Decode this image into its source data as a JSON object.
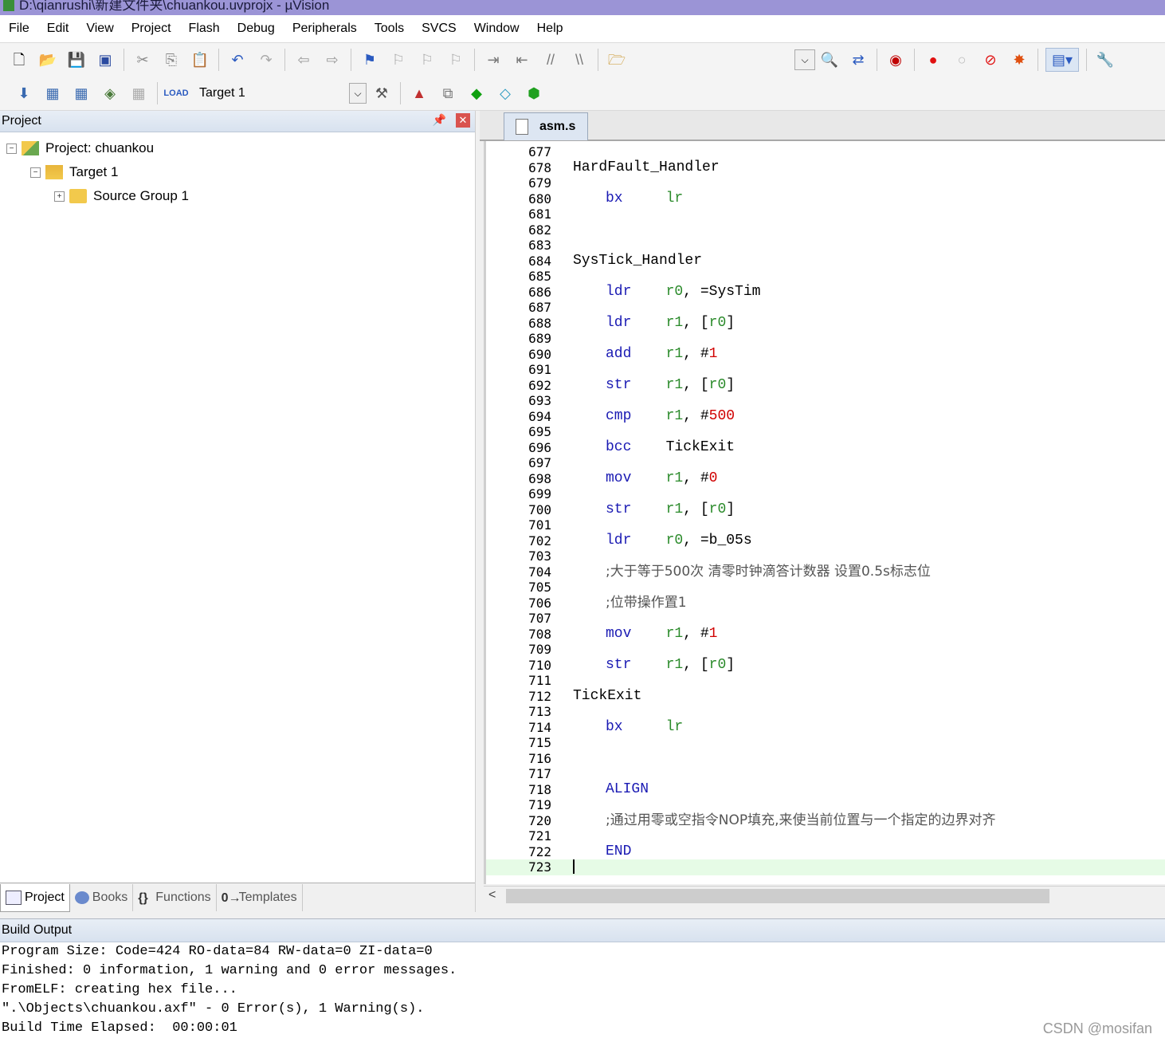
{
  "window": {
    "title": "D:\\qianrushi\\新建文件夹\\chuankou.uvprojx - µVision"
  },
  "menu": [
    "File",
    "Edit",
    "View",
    "Project",
    "Flash",
    "Debug",
    "Peripherals",
    "Tools",
    "SVCS",
    "Window",
    "Help"
  ],
  "toolbar": {
    "target_name": "Target 1"
  },
  "project_panel": {
    "title": "Project",
    "tree": {
      "project": "Project: chuankou",
      "target": "Target 1",
      "group": "Source Group 1"
    },
    "tabs": [
      "Project",
      "Books",
      "Functions",
      "Templates"
    ]
  },
  "editor": {
    "tab": "asm.s",
    "lines": [
      {
        "n": "677",
        "code": ""
      },
      {
        "n": "678",
        "code": "HardFault_Handler"
      },
      {
        "n": "679",
        "code": ""
      },
      {
        "n": "680",
        "code": "bx lr"
      },
      {
        "n": "681",
        "code": ""
      },
      {
        "n": "682",
        "code": ""
      },
      {
        "n": "683",
        "code": ""
      },
      {
        "n": "684",
        "code": "SysTick_Handler"
      },
      {
        "n": "685",
        "code": ""
      },
      {
        "n": "686",
        "code": "ldr r0, =SysTim"
      },
      {
        "n": "687",
        "code": ""
      },
      {
        "n": "688",
        "code": "ldr r1, [r0]"
      },
      {
        "n": "689",
        "code": ""
      },
      {
        "n": "690",
        "code": "add r1, #1"
      },
      {
        "n": "691",
        "code": ""
      },
      {
        "n": "692",
        "code": "str r1, [r0]"
      },
      {
        "n": "693",
        "code": ""
      },
      {
        "n": "694",
        "code": "cmp r1, #500"
      },
      {
        "n": "695",
        "code": ""
      },
      {
        "n": "696",
        "code": "bcc TickExit"
      },
      {
        "n": "697",
        "code": ""
      },
      {
        "n": "698",
        "code": "mov r1, #0"
      },
      {
        "n": "699",
        "code": ""
      },
      {
        "n": "700",
        "code": "str r1, [r0]"
      },
      {
        "n": "701",
        "code": ""
      },
      {
        "n": "702",
        "code": "ldr r0, =b_05s"
      },
      {
        "n": "703",
        "code": ""
      },
      {
        "n": "704",
        "code": ";大于等于500次 清零时钟滴答计数器 设置0.5s标志位"
      },
      {
        "n": "705",
        "code": ""
      },
      {
        "n": "706",
        "code": ";位带操作置1"
      },
      {
        "n": "707",
        "code": ""
      },
      {
        "n": "708",
        "code": "mov r1, #1"
      },
      {
        "n": "709",
        "code": ""
      },
      {
        "n": "710",
        "code": "str r1, [r0]"
      },
      {
        "n": "711",
        "code": ""
      },
      {
        "n": "712",
        "code": "TickExit"
      },
      {
        "n": "713",
        "code": ""
      },
      {
        "n": "714",
        "code": "bx lr"
      },
      {
        "n": "715",
        "code": ""
      },
      {
        "n": "716",
        "code": ""
      },
      {
        "n": "717",
        "code": ""
      },
      {
        "n": "718",
        "code": "ALIGN"
      },
      {
        "n": "719",
        "code": ""
      },
      {
        "n": "720",
        "code": ";通过用零或空指令NOP填充,来使当前位置与一个指定的边界对齐"
      },
      {
        "n": "721",
        "code": ""
      },
      {
        "n": "722",
        "code": "END"
      },
      {
        "n": "723",
        "code": ""
      }
    ]
  },
  "build_output": {
    "title": "Build Output",
    "lines": [
      "Program Size: Code=424 RO-data=84 RW-data=0 ZI-data=0",
      "Finished: 0 information, 1 warning and 0 error messages.",
      "FromELF: creating hex file...",
      "\".\\Objects\\chuankou.axf\" - 0 Error(s), 1 Warning(s).",
      "Build Time Elapsed:  00:00:01"
    ]
  },
  "watermark": "CSDN @mosifan",
  "colors": {
    "keyword": "#1a1ab3",
    "register": "#2a8a2a",
    "number": "#d00000",
    "current_line": "#e6fbe6"
  }
}
